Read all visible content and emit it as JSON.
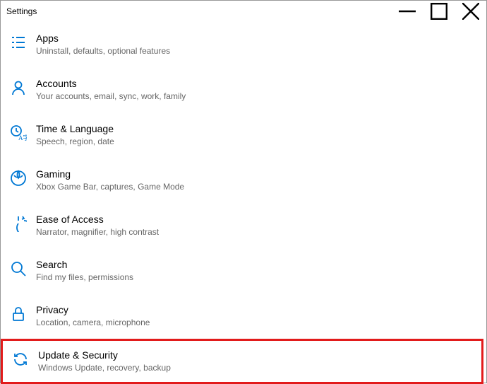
{
  "titlebar": {
    "title": "Settings"
  },
  "categories": [
    {
      "title": "Apps",
      "desc": "Uninstall, defaults, optional features"
    },
    {
      "title": "Accounts",
      "desc": "Your accounts, email, sync, work, family"
    },
    {
      "title": "Time & Language",
      "desc": "Speech, region, date"
    },
    {
      "title": "Gaming",
      "desc": "Xbox Game Bar, captures, Game Mode"
    },
    {
      "title": "Ease of Access",
      "desc": "Narrator, magnifier, high contrast"
    },
    {
      "title": "Search",
      "desc": "Find my files, permissions"
    },
    {
      "title": "Privacy",
      "desc": "Location, camera, microphone"
    },
    {
      "title": "Update & Security",
      "desc": "Windows Update, recovery, backup"
    }
  ]
}
